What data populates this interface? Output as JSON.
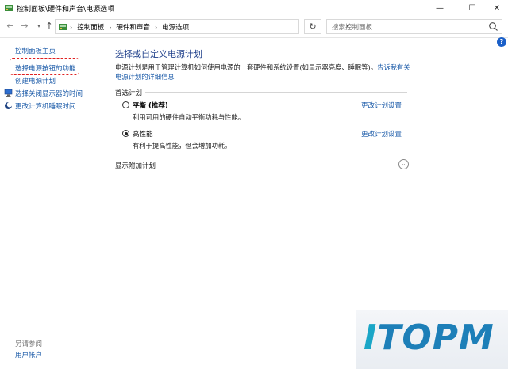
{
  "window": {
    "title": "控制面板\\硬件和声音\\电源选项",
    "min_glyph": "—",
    "max_glyph": "☐",
    "close_glyph": "✕"
  },
  "address": {
    "breadcrumbs": [
      "控制面板",
      "硬件和声音",
      "电源选项"
    ],
    "separator": "›",
    "search_placeholder": "搜索控制面板"
  },
  "sidebar": {
    "home": "控制面板主页",
    "power_buttons": "选择电源按钮的功能",
    "create_plan": "创建电源计划",
    "display_off": "选择关闭显示器的时间",
    "sleep_time": "更改计算机睡眠时间",
    "see_also": "另请参阅",
    "user_accounts": "用户帐户"
  },
  "main": {
    "title": "选择或自定义电源计划",
    "description": "电源计划是用于管理计算机如何使用电源的一套硬件和系统设置(如显示器亮度、睡眠等)。",
    "description_link": "告诉我有关电源计划的详细信息",
    "preferred_plans": "首选计划",
    "plans": [
      {
        "name": "平衡",
        "tag": "(推荐)",
        "description": "利用可用的硬件自动平衡功耗与性能。",
        "change_link": "更改计划设置",
        "selected": false
      },
      {
        "name": "高性能",
        "tag": "",
        "description": "有利于提高性能，但会增加功耗。",
        "change_link": "更改计划设置",
        "selected": true
      }
    ],
    "show_additional": "显示附加计划"
  },
  "logo": {
    "brand_i": "I",
    "brand_rest": "TOPM"
  },
  "colors": {
    "link": "#1a5aa8",
    "title": "#1e3f8a",
    "highlight": "#e02020",
    "logo_primary": "#1d7fb8",
    "logo_accent": "#1aa6c7"
  }
}
